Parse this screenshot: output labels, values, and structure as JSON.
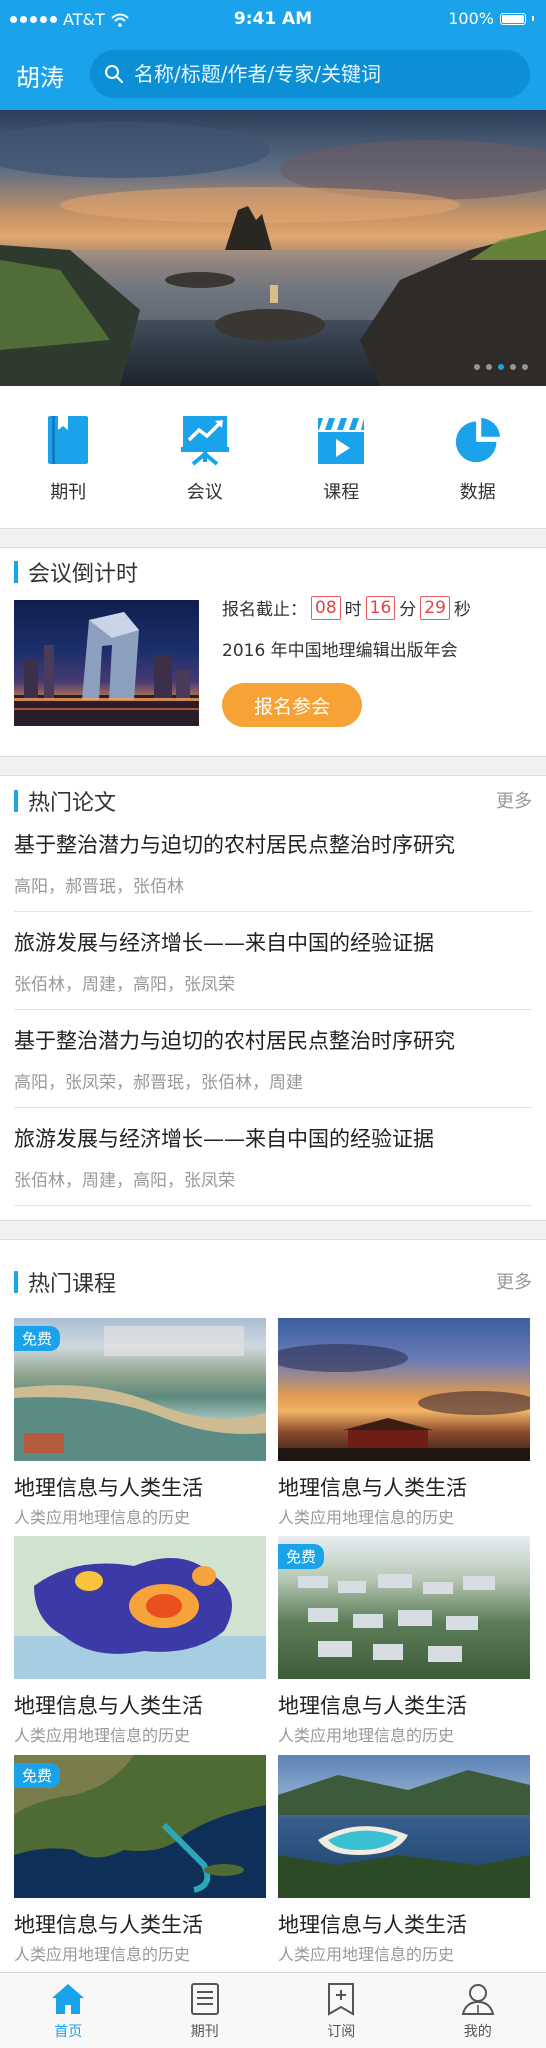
{
  "status": {
    "carrier": "AT&T",
    "time": "9:41 AM",
    "battery": "100%"
  },
  "header": {
    "city": "胡涛",
    "search_placeholder": "名称/标题/作者/专家/关键词"
  },
  "banner": {
    "page_count": 5,
    "active_page": 3
  },
  "categories": [
    {
      "label": "期刊",
      "icon": "journal-icon"
    },
    {
      "label": "会议",
      "icon": "presentation-icon"
    },
    {
      "label": "课程",
      "icon": "video-icon"
    },
    {
      "label": "数据",
      "icon": "pie-chart-icon"
    }
  ],
  "conference": {
    "section_title": "会议倒计时",
    "deadline_label": "报名截止：",
    "hours": "08",
    "hours_unit": "时",
    "minutes": "16",
    "minutes_unit": "分",
    "seconds": "29",
    "seconds_unit": "秒",
    "name": "2016 年中国地理编辑出版年会",
    "signup_label": "报名参会"
  },
  "papers": {
    "section_title": "热门论文",
    "more": "更多",
    "items": [
      {
        "title": "基于整治潜力与迫切的农村居民点整治时序研究",
        "authors": "高阳，郝晋珉，张佰林"
      },
      {
        "title": "旅游发展与经济增长——来自中国的经验证据",
        "authors": "张佰林，周建，高阳，张凤荣"
      },
      {
        "title": "基于整治潜力与迫切的农村居民点整治时序研究",
        "authors": "高阳，张凤荣，郝晋珉，张佰林，周建"
      },
      {
        "title": "旅游发展与经济增长——来自中国的经验证据",
        "authors": "张佰林，周建，高阳，张凤荣"
      }
    ]
  },
  "courses": {
    "section_title": "热门课程",
    "more": "更多",
    "free_label": "免费",
    "items": [
      {
        "title": "地理信息与人类生活",
        "subtitle": "人类应用地理信息的历史",
        "free": true
      },
      {
        "title": "地理信息与人类生活",
        "subtitle": "人类应用地理信息的历史",
        "free": false
      },
      {
        "title": "地理信息与人类生活",
        "subtitle": "人类应用地理信息的历史",
        "free": false
      },
      {
        "title": "地理信息与人类生活",
        "subtitle": "人类应用地理信息的历史",
        "free": true
      },
      {
        "title": "地理信息与人类生活",
        "subtitle": "人类应用地理信息的历史",
        "free": true
      },
      {
        "title": "地理信息与人类生活",
        "subtitle": "人类应用地理信息的历史",
        "free": false
      }
    ]
  },
  "tabbar": [
    {
      "label": "首页",
      "icon": "home-icon",
      "active": true
    },
    {
      "label": "期刊",
      "icon": "journal-tab-icon",
      "active": false
    },
    {
      "label": "订阅",
      "icon": "subscribe-icon",
      "active": false
    },
    {
      "label": "我的",
      "icon": "profile-icon",
      "active": false
    }
  ],
  "colors": {
    "primary": "#1aa3ea",
    "accent": "#f7a234",
    "countdown": "#e04343"
  }
}
